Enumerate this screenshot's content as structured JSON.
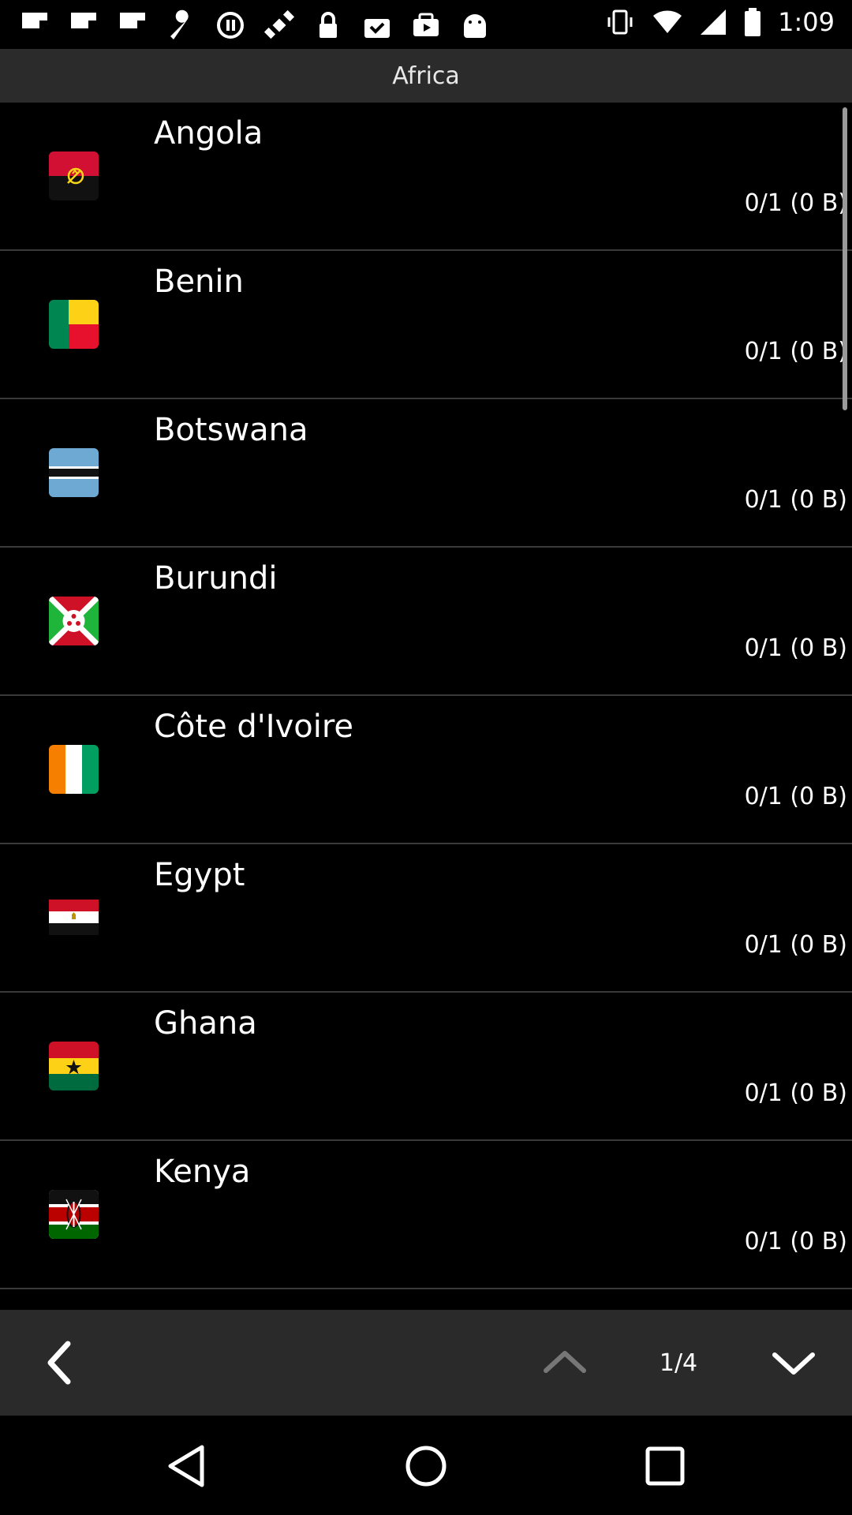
{
  "status_bar": {
    "time": "1:09",
    "icons": [
      "flipboard-icon",
      "flipboard-icon",
      "flipboard-icon",
      "wrench-icon",
      "circle-pause-icon",
      "satellite-fake-gps-icon",
      "lock-icon",
      "clipboard-check-icon",
      "youtube-icon",
      "android-icon",
      "vibrate-icon",
      "wifi-icon",
      "signal-icon",
      "battery-icon"
    ]
  },
  "header": {
    "title": "Africa"
  },
  "countries": [
    {
      "name": "Angola",
      "count": "0/1 (0 B)",
      "flag_icon": "flag-angola-icon"
    },
    {
      "name": "Benin",
      "count": "0/1 (0 B)",
      "flag_icon": "flag-benin-icon"
    },
    {
      "name": "Botswana",
      "count": "0/1 (0 B)",
      "flag_icon": "flag-botswana-icon"
    },
    {
      "name": "Burundi",
      "count": "0/1 (0 B)",
      "flag_icon": "flag-burundi-icon"
    },
    {
      "name": "Côte d'Ivoire",
      "count": "0/1 (0 B)",
      "flag_icon": "flag-cote-divoire-icon"
    },
    {
      "name": "Egypt",
      "count": "0/1 (0 B)",
      "flag_icon": "flag-egypt-icon"
    },
    {
      "name": "Ghana",
      "count": "0/1 (0 B)",
      "flag_icon": "flag-ghana-icon"
    },
    {
      "name": "Kenya",
      "count": "0/1 (0 B)",
      "flag_icon": "flag-kenya-icon"
    }
  ],
  "footer": {
    "back_icon": "chevron-left-icon",
    "up_icon": "chevron-up-icon",
    "page": "1/4",
    "down_icon": "chevron-down-icon"
  },
  "navbar": {
    "back": "nav-back-icon",
    "home": "nav-home-icon",
    "recents": "nav-recents-icon"
  },
  "colors": {
    "background": "#000000",
    "header": "#2b2b2b",
    "footer": "#2a2a2a",
    "divider": "#3a3a3a"
  }
}
